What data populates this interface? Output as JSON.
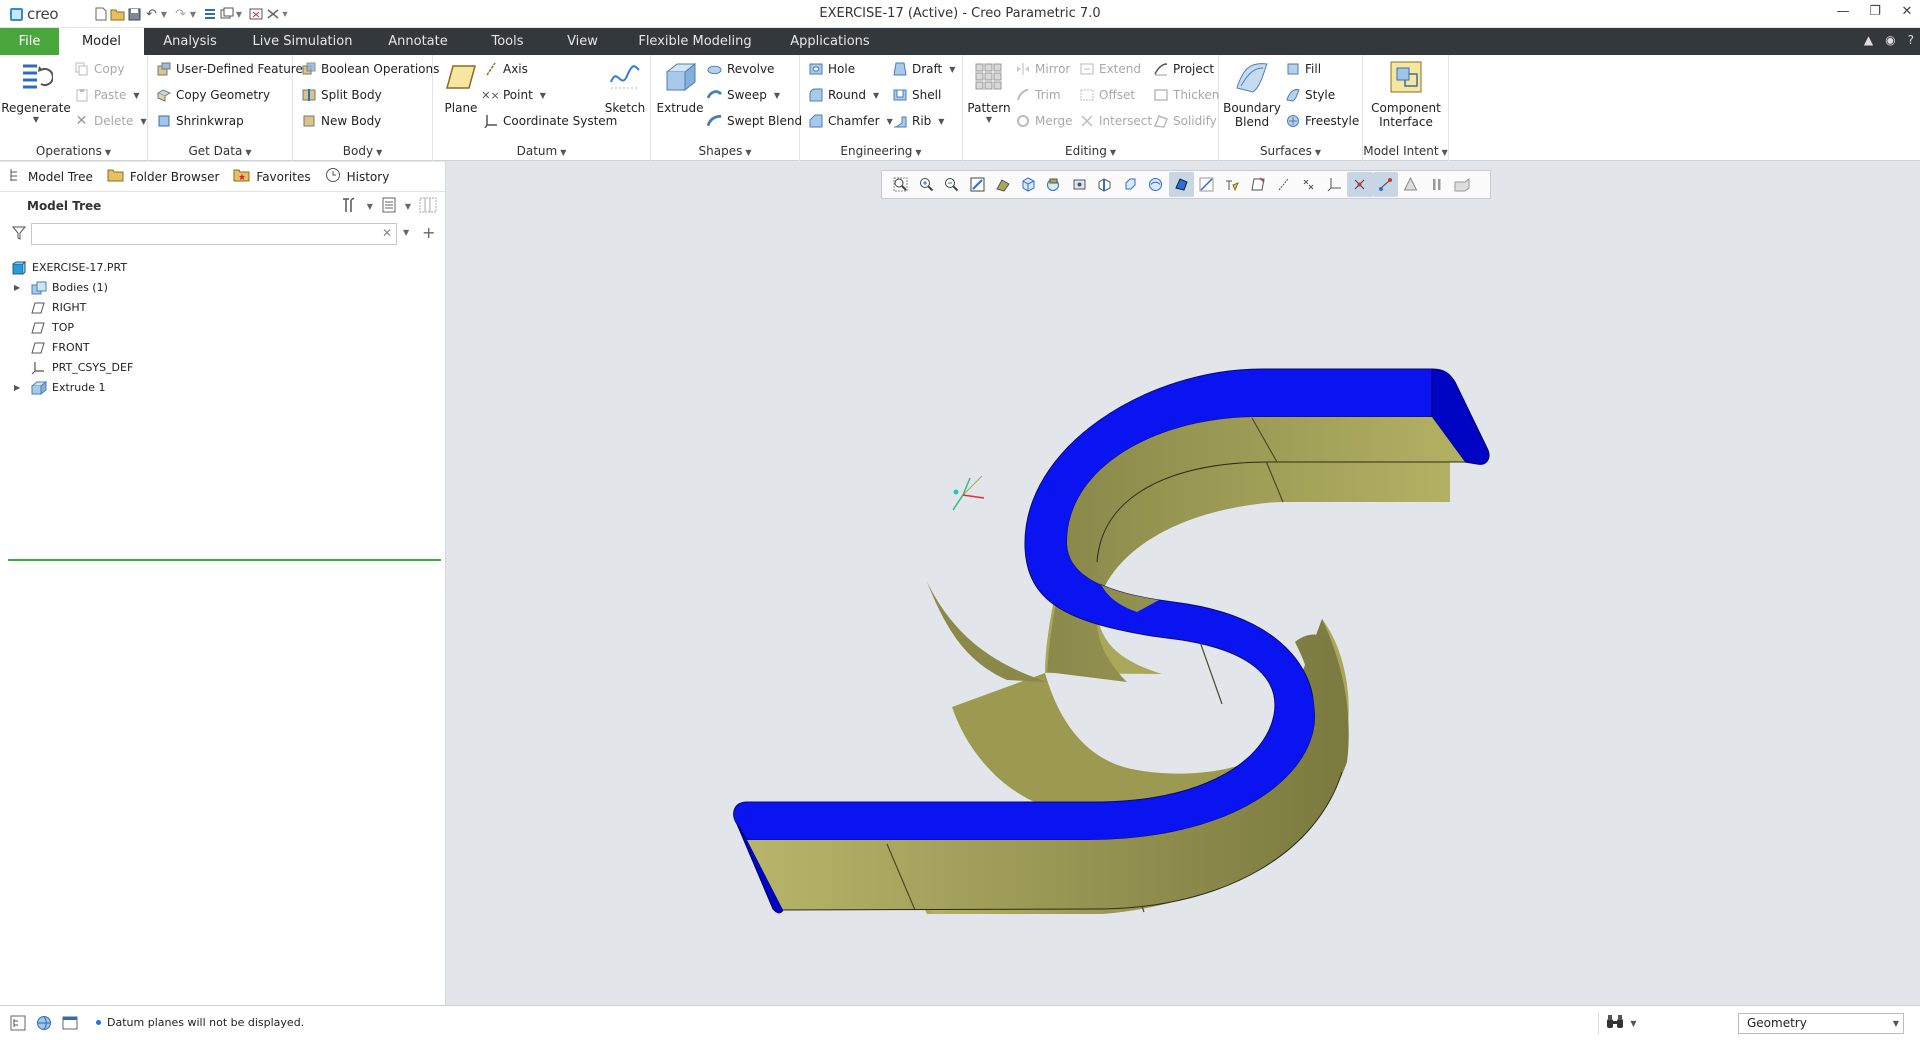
{
  "app": {
    "logo_text": "creo",
    "window_title": "EXERCISE-17 (Active) - Creo Parametric 7.0"
  },
  "ribbon_tabs": [
    "File",
    "Model",
    "Analysis",
    "Live Simulation",
    "Annotate",
    "Tools",
    "View",
    "Flexible Modeling",
    "Applications"
  ],
  "ribbon": {
    "operations": {
      "label": "Operations",
      "regenerate": "Regenerate",
      "copy": "Copy",
      "paste": "Paste",
      "delete": "Delete"
    },
    "get_data": {
      "label": "Get Data",
      "user_defined_feature": "User-Defined Feature",
      "copy_geometry": "Copy Geometry",
      "shrinkwrap": "Shrinkwrap"
    },
    "body": {
      "label": "Body",
      "boolean_operations": "Boolean Operations",
      "split_body": "Split Body",
      "new_body": "New Body"
    },
    "datum": {
      "label": "Datum",
      "plane": "Plane",
      "axis": "Axis",
      "point": "Point",
      "coordinate_system": "Coordinate System",
      "sketch": "Sketch"
    },
    "shapes": {
      "label": "Shapes",
      "extrude": "Extrude",
      "revolve": "Revolve",
      "sweep": "Sweep",
      "swept_blend": "Swept Blend"
    },
    "engineering": {
      "label": "Engineering",
      "hole": "Hole",
      "round": "Round",
      "chamfer": "Chamfer",
      "draft": "Draft",
      "shell": "Shell",
      "rib": "Rib"
    },
    "editing": {
      "label": "Editing",
      "pattern": "Pattern",
      "mirror": "Mirror",
      "trim": "Trim",
      "merge": "Merge",
      "extend": "Extend",
      "offset": "Offset",
      "intersect": "Intersect",
      "project": "Project",
      "thicken": "Thicken",
      "solidify": "Solidify"
    },
    "surfaces": {
      "label": "Surfaces",
      "boundary_blend": "Boundary Blend",
      "fill": "Fill",
      "style": "Style",
      "freestyle": "Freestyle"
    },
    "model_intent": {
      "label": "Model Intent",
      "component_interface": "Component Interface"
    }
  },
  "panel": {
    "tabs": [
      "Model Tree",
      "Folder Browser",
      "Favorites",
      "History"
    ],
    "tree_title": "Model Tree",
    "search_value": "",
    "tree": [
      {
        "label": "EXERCISE-17.PRT",
        "icon": "part-icon",
        "level": 0,
        "expandable": false
      },
      {
        "label": "Bodies (1)",
        "icon": "bodies-icon",
        "level": 1,
        "expandable": true
      },
      {
        "label": "RIGHT",
        "icon": "datum-plane-icon",
        "level": 1,
        "expandable": false
      },
      {
        "label": "TOP",
        "icon": "datum-plane-icon",
        "level": 1,
        "expandable": false
      },
      {
        "label": "FRONT",
        "icon": "datum-plane-icon",
        "level": 1,
        "expandable": false
      },
      {
        "label": "PRT_CSYS_DEF",
        "icon": "csys-icon",
        "level": 1,
        "expandable": false
      },
      {
        "label": "Extrude 1",
        "icon": "extrude-icon",
        "level": 1,
        "expandable": true
      }
    ]
  },
  "status": {
    "message": "Datum planes will not be displayed.",
    "filter_value": "Geometry"
  },
  "colors": {
    "file_tab": "#49a63d",
    "tab_bar": "#32383c",
    "model_face": "#0a14f0",
    "model_side": "#a8a75a",
    "tree_end_line": "#3cac3c"
  }
}
